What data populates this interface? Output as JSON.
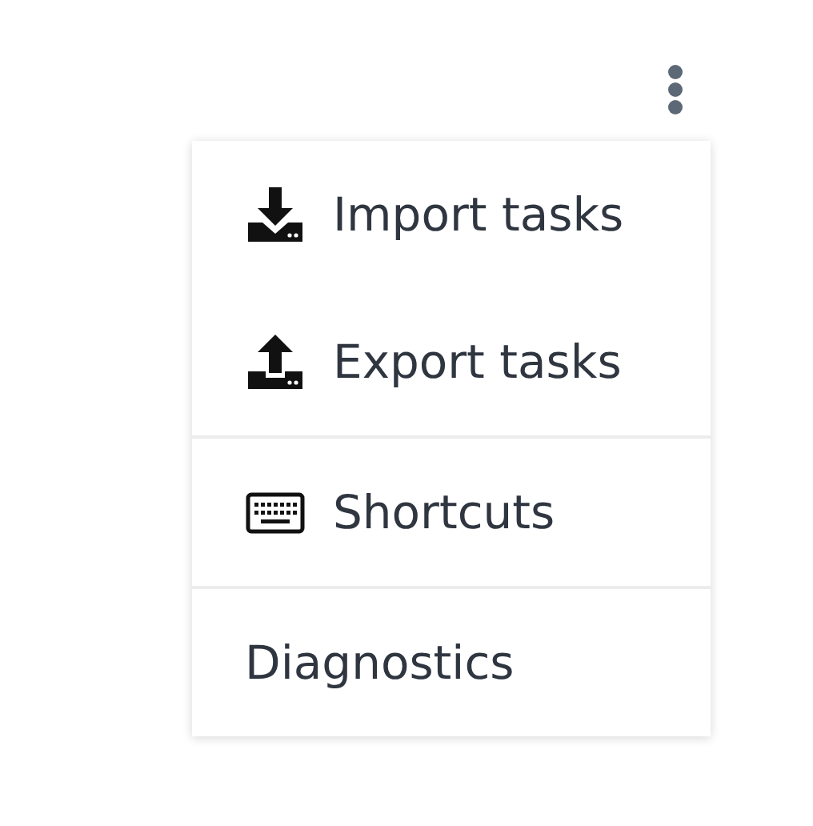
{
  "menu": {
    "sections": [
      {
        "items": [
          {
            "label": "Import tasks",
            "kind": "import"
          },
          {
            "label": "Export tasks",
            "kind": "export"
          }
        ]
      },
      {
        "items": [
          {
            "label": "Shortcuts",
            "kind": "shortcuts"
          }
        ]
      },
      {
        "items": [
          {
            "label": "Diagnostics",
            "kind": "plain"
          }
        ]
      }
    ]
  }
}
